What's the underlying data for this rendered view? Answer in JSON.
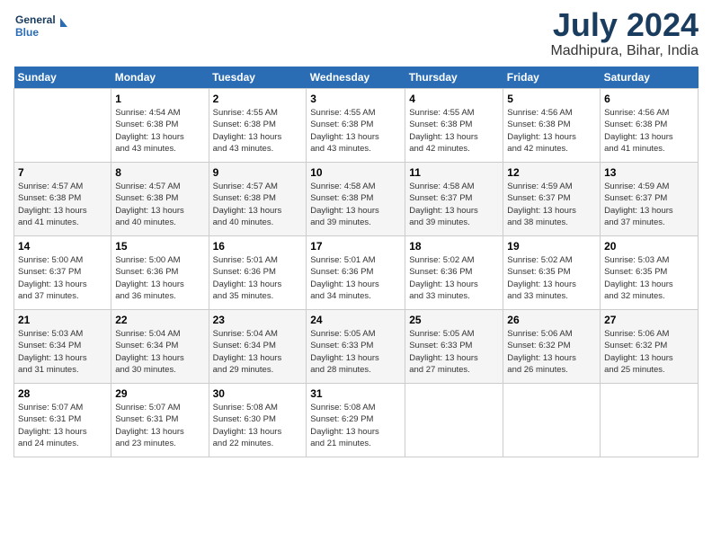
{
  "header": {
    "logo_line1": "General",
    "logo_line2": "Blue",
    "month": "July 2024",
    "location": "Madhipura, Bihar, India"
  },
  "calendar": {
    "headers": [
      "Sunday",
      "Monday",
      "Tuesday",
      "Wednesday",
      "Thursday",
      "Friday",
      "Saturday"
    ],
    "weeks": [
      [
        {
          "day": "",
          "info": ""
        },
        {
          "day": "1",
          "info": "Sunrise: 4:54 AM\nSunset: 6:38 PM\nDaylight: 13 hours\nand 43 minutes."
        },
        {
          "day": "2",
          "info": "Sunrise: 4:55 AM\nSunset: 6:38 PM\nDaylight: 13 hours\nand 43 minutes."
        },
        {
          "day": "3",
          "info": "Sunrise: 4:55 AM\nSunset: 6:38 PM\nDaylight: 13 hours\nand 43 minutes."
        },
        {
          "day": "4",
          "info": "Sunrise: 4:55 AM\nSunset: 6:38 PM\nDaylight: 13 hours\nand 42 minutes."
        },
        {
          "day": "5",
          "info": "Sunrise: 4:56 AM\nSunset: 6:38 PM\nDaylight: 13 hours\nand 42 minutes."
        },
        {
          "day": "6",
          "info": "Sunrise: 4:56 AM\nSunset: 6:38 PM\nDaylight: 13 hours\nand 41 minutes."
        }
      ],
      [
        {
          "day": "7",
          "info": "Sunrise: 4:57 AM\nSunset: 6:38 PM\nDaylight: 13 hours\nand 41 minutes."
        },
        {
          "day": "8",
          "info": "Sunrise: 4:57 AM\nSunset: 6:38 PM\nDaylight: 13 hours\nand 40 minutes."
        },
        {
          "day": "9",
          "info": "Sunrise: 4:57 AM\nSunset: 6:38 PM\nDaylight: 13 hours\nand 40 minutes."
        },
        {
          "day": "10",
          "info": "Sunrise: 4:58 AM\nSunset: 6:38 PM\nDaylight: 13 hours\nand 39 minutes."
        },
        {
          "day": "11",
          "info": "Sunrise: 4:58 AM\nSunset: 6:37 PM\nDaylight: 13 hours\nand 39 minutes."
        },
        {
          "day": "12",
          "info": "Sunrise: 4:59 AM\nSunset: 6:37 PM\nDaylight: 13 hours\nand 38 minutes."
        },
        {
          "day": "13",
          "info": "Sunrise: 4:59 AM\nSunset: 6:37 PM\nDaylight: 13 hours\nand 37 minutes."
        }
      ],
      [
        {
          "day": "14",
          "info": "Sunrise: 5:00 AM\nSunset: 6:37 PM\nDaylight: 13 hours\nand 37 minutes."
        },
        {
          "day": "15",
          "info": "Sunrise: 5:00 AM\nSunset: 6:36 PM\nDaylight: 13 hours\nand 36 minutes."
        },
        {
          "day": "16",
          "info": "Sunrise: 5:01 AM\nSunset: 6:36 PM\nDaylight: 13 hours\nand 35 minutes."
        },
        {
          "day": "17",
          "info": "Sunrise: 5:01 AM\nSunset: 6:36 PM\nDaylight: 13 hours\nand 34 minutes."
        },
        {
          "day": "18",
          "info": "Sunrise: 5:02 AM\nSunset: 6:36 PM\nDaylight: 13 hours\nand 33 minutes."
        },
        {
          "day": "19",
          "info": "Sunrise: 5:02 AM\nSunset: 6:35 PM\nDaylight: 13 hours\nand 33 minutes."
        },
        {
          "day": "20",
          "info": "Sunrise: 5:03 AM\nSunset: 6:35 PM\nDaylight: 13 hours\nand 32 minutes."
        }
      ],
      [
        {
          "day": "21",
          "info": "Sunrise: 5:03 AM\nSunset: 6:34 PM\nDaylight: 13 hours\nand 31 minutes."
        },
        {
          "day": "22",
          "info": "Sunrise: 5:04 AM\nSunset: 6:34 PM\nDaylight: 13 hours\nand 30 minutes."
        },
        {
          "day": "23",
          "info": "Sunrise: 5:04 AM\nSunset: 6:34 PM\nDaylight: 13 hours\nand 29 minutes."
        },
        {
          "day": "24",
          "info": "Sunrise: 5:05 AM\nSunset: 6:33 PM\nDaylight: 13 hours\nand 28 minutes."
        },
        {
          "day": "25",
          "info": "Sunrise: 5:05 AM\nSunset: 6:33 PM\nDaylight: 13 hours\nand 27 minutes."
        },
        {
          "day": "26",
          "info": "Sunrise: 5:06 AM\nSunset: 6:32 PM\nDaylight: 13 hours\nand 26 minutes."
        },
        {
          "day": "27",
          "info": "Sunrise: 5:06 AM\nSunset: 6:32 PM\nDaylight: 13 hours\nand 25 minutes."
        }
      ],
      [
        {
          "day": "28",
          "info": "Sunrise: 5:07 AM\nSunset: 6:31 PM\nDaylight: 13 hours\nand 24 minutes."
        },
        {
          "day": "29",
          "info": "Sunrise: 5:07 AM\nSunset: 6:31 PM\nDaylight: 13 hours\nand 23 minutes."
        },
        {
          "day": "30",
          "info": "Sunrise: 5:08 AM\nSunset: 6:30 PM\nDaylight: 13 hours\nand 22 minutes."
        },
        {
          "day": "31",
          "info": "Sunrise: 5:08 AM\nSunset: 6:29 PM\nDaylight: 13 hours\nand 21 minutes."
        },
        {
          "day": "",
          "info": ""
        },
        {
          "day": "",
          "info": ""
        },
        {
          "day": "",
          "info": ""
        }
      ]
    ]
  }
}
